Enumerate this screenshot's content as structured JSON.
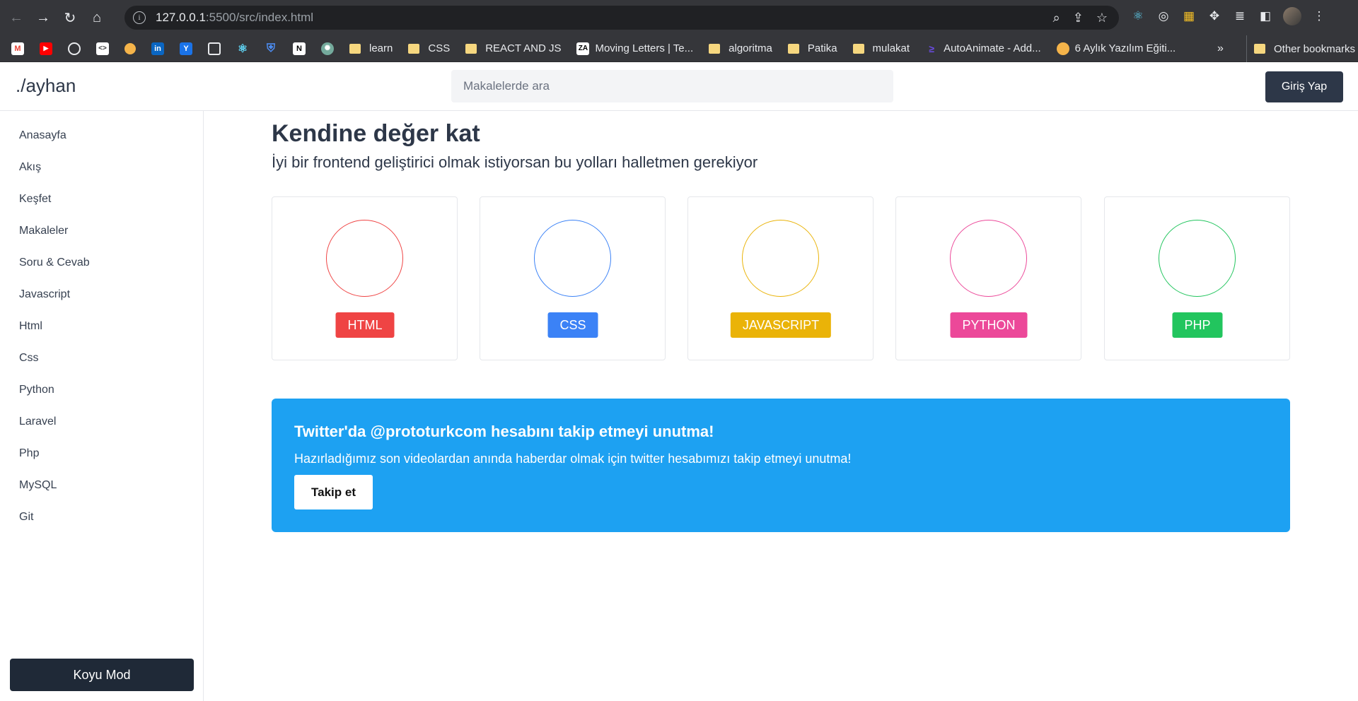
{
  "browser": {
    "url_host": "127.0.0.1",
    "url_rest": ":5500/src/index.html",
    "bookmarks": [
      {
        "label": "learn"
      },
      {
        "label": "CSS"
      },
      {
        "label": "REACT AND JS"
      },
      {
        "label": "Moving Letters | Te..."
      },
      {
        "label": "algoritma"
      },
      {
        "label": "Patika"
      },
      {
        "label": "mulakat"
      },
      {
        "label": "AutoAnimate - Add..."
      },
      {
        "label": "6 Aylık Yazılım Eğiti..."
      }
    ],
    "more": "»",
    "other_bookmarks": "Other bookmarks"
  },
  "header": {
    "logo": "./ayhan",
    "search_placeholder": "Makalelerde ara",
    "login": "Giriş Yap"
  },
  "sidebar": {
    "items": [
      "Anasayfa",
      "Akış",
      "Keşfet",
      "Makaleler",
      "Soru & Cevab",
      "Javascript",
      "Html",
      "Css",
      "Python",
      "Laravel",
      "Php",
      "MySQL",
      "Git"
    ],
    "dark_mode": "Koyu Mod"
  },
  "main": {
    "title": "Kendine değer kat",
    "subtitle": "İyi bir frontend geliştirici olmak istiyorsan bu yolları halletmen gerekiyor",
    "cards": [
      {
        "label": "HTML",
        "color": "#ef4444"
      },
      {
        "label": "CSS",
        "color": "#3b82f6"
      },
      {
        "label": "JAVASCRIPT",
        "color": "#eab308"
      },
      {
        "label": "PYTHON",
        "color": "#ec4899"
      },
      {
        "label": "PHP",
        "color": "#22c55e"
      }
    ]
  },
  "twitter": {
    "title": "Twitter'da @prototurkcom hesabını takip etmeyi unutma!",
    "text": "Hazırladığımız son videolardan anında haberdar olmak için twitter hesabımızı takip etmeyi unutma!",
    "button": "Takip et",
    "color": "#1da1f2"
  }
}
